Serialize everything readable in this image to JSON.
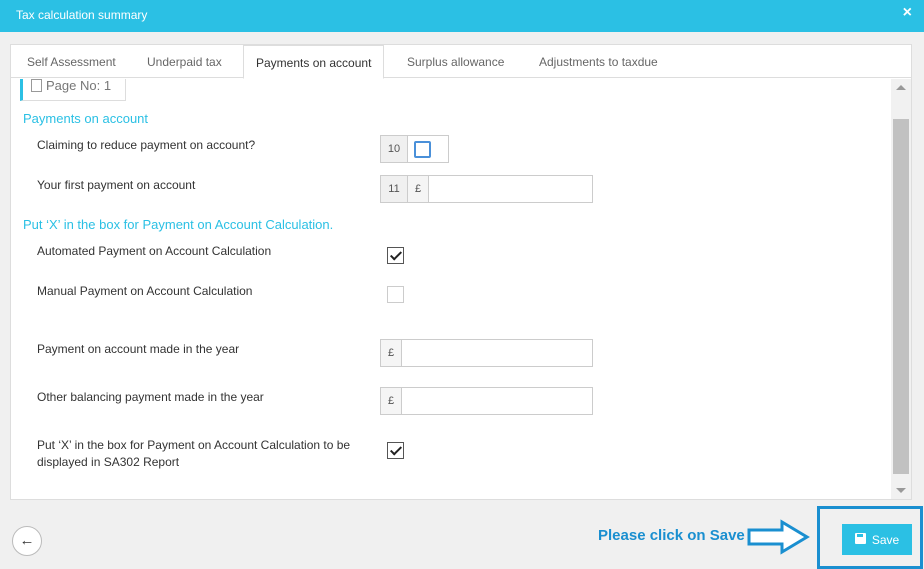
{
  "window": {
    "title": "Tax calculation summary",
    "close_icon": "×"
  },
  "tabs": [
    {
      "label": "Self Assessment"
    },
    {
      "label": "Underpaid tax"
    },
    {
      "label": "Payments on account",
      "active": true
    },
    {
      "label": "Surplus allowance"
    },
    {
      "label": "Adjustments to taxdue"
    }
  ],
  "page_indicator": "Page No: 1",
  "sections": {
    "payments_on_account": "Payments on account",
    "put_x_heading": "Put ‘X’ in the box for Payment on Account Calculation."
  },
  "fields": {
    "claiming_reduce": {
      "label": "Claiming to reduce payment on account?",
      "box_number": "10",
      "checked": false
    },
    "first_payment": {
      "label": "Your first payment on account",
      "box_number": "11",
      "currency": "£",
      "value": ""
    },
    "automated_calc": {
      "label": "Automated Payment on Account Calculation",
      "checked": true
    },
    "manual_calc": {
      "label": "Manual Payment on Account Calculation",
      "checked": false
    },
    "payment_made_year": {
      "label": "Payment on account made in the year",
      "currency": "£",
      "value": ""
    },
    "other_balancing": {
      "label": "Other balancing payment made in the year",
      "currency": "£",
      "value": ""
    },
    "sa302_display": {
      "label": "Put ‘X’ in the box for Payment on Account Calculation to be displayed in SA302 Report",
      "checked": true
    }
  },
  "footer": {
    "hint": "Please click on Save",
    "save_label": "Save",
    "back_icon": "←"
  },
  "colors": {
    "accent": "#2bc0e4",
    "hint": "#1a8fd0"
  }
}
